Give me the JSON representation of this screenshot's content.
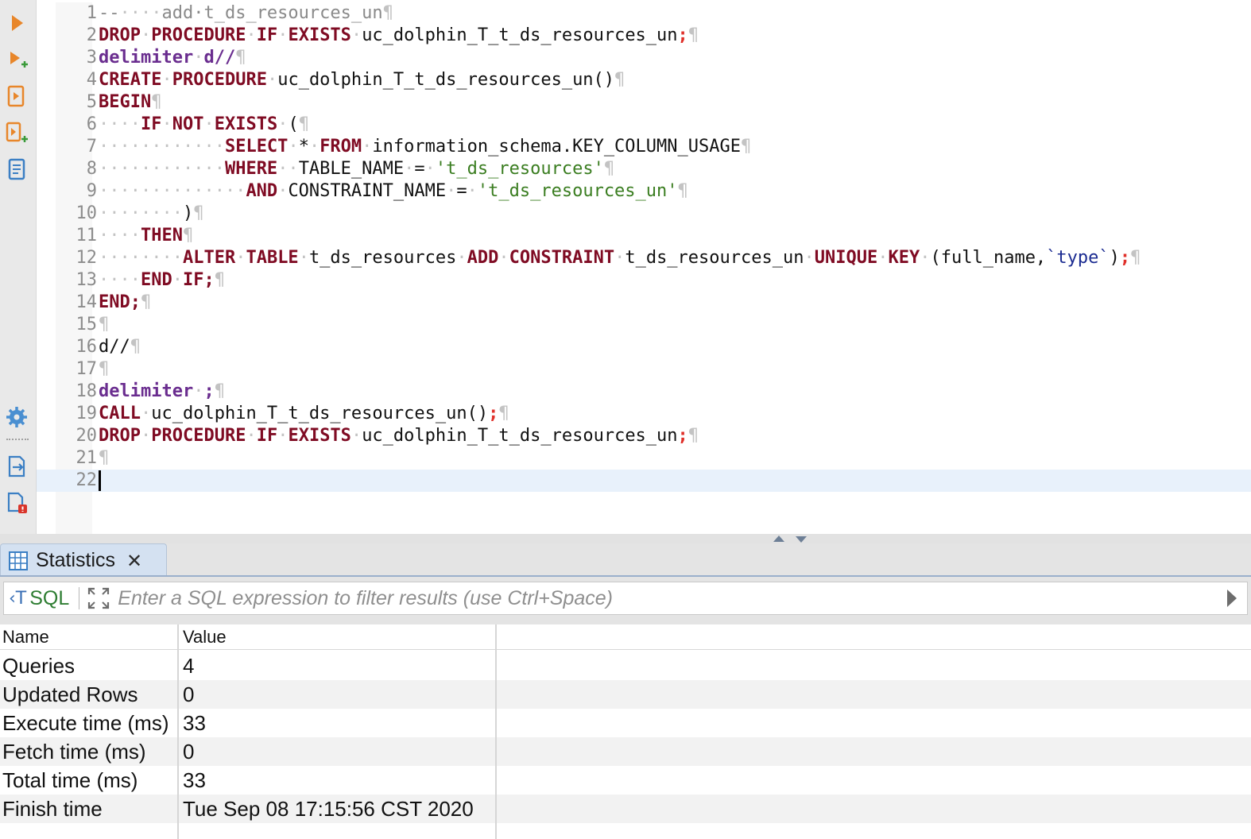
{
  "toolbar": {
    "icons": [
      "execute-statement-icon",
      "execute-in-new-tab-icon",
      "execute-script-icon",
      "execute-script-new-tab-icon",
      "explain-plan-icon",
      "settings-icon",
      "export-icon",
      "error-log-icon"
    ]
  },
  "editor": {
    "lines": [
      {
        "num": "1"
      },
      {
        "num": "2"
      },
      {
        "num": "3"
      },
      {
        "num": "4"
      },
      {
        "num": "5"
      },
      {
        "num": "6"
      },
      {
        "num": "7"
      },
      {
        "num": "8"
      },
      {
        "num": "9"
      },
      {
        "num": "10"
      },
      {
        "num": "11"
      },
      {
        "num": "12"
      },
      {
        "num": "13"
      },
      {
        "num": "14"
      },
      {
        "num": "15"
      },
      {
        "num": "16"
      },
      {
        "num": "17"
      },
      {
        "num": "18"
      },
      {
        "num": "19"
      },
      {
        "num": "20"
      },
      {
        "num": "21"
      },
      {
        "num": "22"
      }
    ],
    "code": {
      "l1_dash": "--",
      "l1_text": "add·t_ds_resources_un",
      "drop": "DROP",
      "procedure": "PROCEDURE",
      "if": "IF",
      "exists": "EXISTS",
      "proc_name": "uc_dolphin_T_t_ds_resources_un",
      "delimiter": "delimiter",
      "delim_d": "d//",
      "create": "CREATE",
      "proc_call": "uc_dolphin_T_t_ds_resources_un()",
      "begin": "BEGIN",
      "not": "NOT",
      "paren_open": "(",
      "select": "SELECT",
      "star": "*",
      "from": "FROM",
      "schema_table": "information_schema.KEY_COLUMN_USAGE",
      "where": "WHERE",
      "table_name_col": "TABLE_NAME",
      "eq": "=",
      "str_table": "'t_ds_resources'",
      "and": "AND",
      "constraint_name_col": "CONSTRAINT_NAME",
      "str_constraint": "'t_ds_resources_un'",
      "paren_close": ")",
      "then": "THEN",
      "alter": "ALTER",
      "table": "TABLE",
      "t_ds_resources": "t_ds_resources",
      "add": "ADD",
      "constraint": "CONSTRAINT",
      "t_ds_resources_un": "t_ds_resources_un",
      "unique": "UNIQUE",
      "key": "KEY",
      "cols_open": "(full_name,",
      "type_col": "`type`",
      "cols_close": ")",
      "end": "END",
      "end_semi": "END;",
      "if_semi": "IF;",
      "d_slash": "d//",
      "semi": ";",
      "call": "CALL",
      "call_expr": "uc_dolphin_T_t_ds_resources_un()",
      "pilcrow": "¶"
    }
  },
  "panel": {
    "tab_label": "Statistics",
    "sql_button_label": "SQL",
    "filter_placeholder": "Enter a SQL expression to filter results (use Ctrl+Space)",
    "columns": [
      "Name",
      "Value"
    ],
    "rows": [
      {
        "name": "Queries",
        "value": "4"
      },
      {
        "name": "Updated Rows",
        "value": "0"
      },
      {
        "name": "Execute time (ms)",
        "value": "33"
      },
      {
        "name": "Fetch time (ms)",
        "value": "0"
      },
      {
        "name": "Total time (ms)",
        "value": "33"
      },
      {
        "name": "Finish time",
        "value": "Tue Sep 08 17:15:56 CST 2020"
      }
    ]
  },
  "colors": {
    "keyword": "#7f0b23",
    "delimiter_keyword": "#6a2d8f",
    "string": "#3a7d20",
    "comment": "#8a8a8a",
    "current_line": "#e8f1fb",
    "tab_active": "#d4e1f1"
  }
}
